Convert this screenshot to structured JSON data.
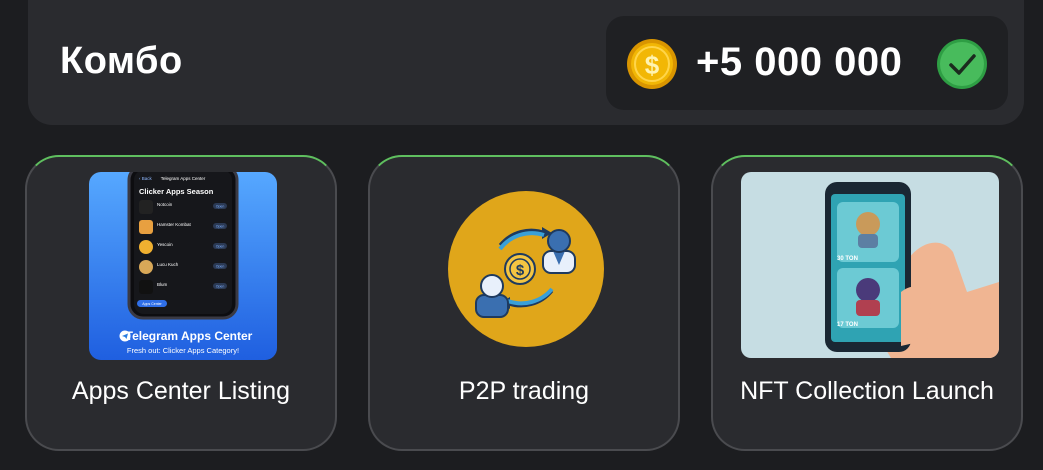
{
  "header": {
    "title": "Комбо"
  },
  "reward": {
    "amount": "+5 000 000",
    "coin_icon": "coin-icon",
    "status_icon": "checkmark-icon",
    "status": "claimed"
  },
  "cards": [
    {
      "label": "Apps Center Listing",
      "image": {
        "back": "Back",
        "app_title": "Telegram Apps Center",
        "heading": "Clicker Apps Season",
        "apps": [
          "Notcoin",
          "Hamster Kombat",
          "Yescoin",
          "Lucu Kuch",
          "Blum"
        ],
        "open_label": "Open",
        "banner_title": "Telegram Apps Center",
        "banner_subtitle": "Fresh out: Clicker Apps Category!",
        "bottom_tab": "Apps Center"
      }
    },
    {
      "label": "P2P trading",
      "image": {
        "icon": "p2p-exchange-icon"
      }
    },
    {
      "label": "NFT Collection Launch",
      "image": {
        "nft_1_price": "30 TON",
        "nft_2_price": "17 TON"
      }
    }
  ],
  "colors": {
    "background": "#1c1d20",
    "panel": "#2a2b2f",
    "accent_green": "#5fbf5f",
    "coin_gold": "#f2b705",
    "p2p_circle": "#e0a61a"
  }
}
